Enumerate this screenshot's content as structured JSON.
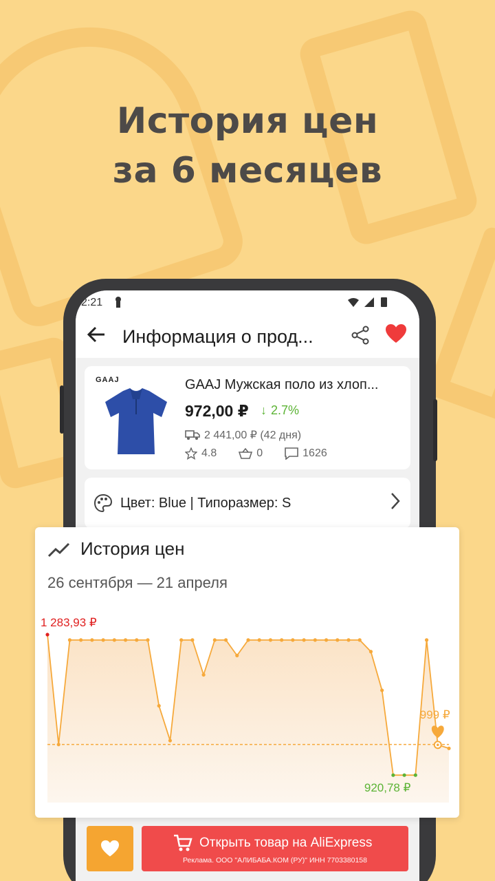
{
  "headline": {
    "line1": "История цен",
    "line2": "за 6 месяцев"
  },
  "statusbar": {
    "time": "2:21"
  },
  "appbar": {
    "title": "Информация о прод..."
  },
  "product": {
    "brand": "GAAJ",
    "name": "GAAJ Мужская поло из хлоп...",
    "price": "972,00 ₽",
    "drop": "2.7%",
    "shipping": "2 441,00 ₽ (42 дня)",
    "rating": "4.8",
    "orders": "0",
    "reviews": "1626"
  },
  "variant": {
    "text": "Цвет: Blue | Типоразмер: S"
  },
  "history": {
    "title": "История цен",
    "range": "26 сентября — 21 апреля"
  },
  "chart_data": {
    "type": "area",
    "max_label": "1 283,93 ₽",
    "min_label": "920,78 ₽",
    "current_label": "999 ₽",
    "ylim": [
      850,
      1300
    ],
    "average": 1000,
    "values": [
      1283.93,
      1000,
      1270,
      1270,
      1270,
      1270,
      1270,
      1270,
      1270,
      1270,
      1100,
      1010,
      1270,
      1270,
      1180,
      1270,
      1270,
      1230,
      1270,
      1270,
      1270,
      1270,
      1270,
      1270,
      1270,
      1270,
      1270,
      1270,
      1270,
      1240,
      1140,
      920.78,
      920.78,
      920.78,
      1270,
      999,
      990
    ],
    "colors": {
      "line": "#f6a93b",
      "fill": "#fbe3c6",
      "max": "#e02020",
      "min": "#5cb335",
      "current": "#f6a93b"
    }
  },
  "bottom": {
    "open_label": "Открыть товар на AliExpress",
    "ad_text": "Реклама. ООО \"АЛИБАБА.КОМ (РУ)\" ИНН  7703380158"
  }
}
